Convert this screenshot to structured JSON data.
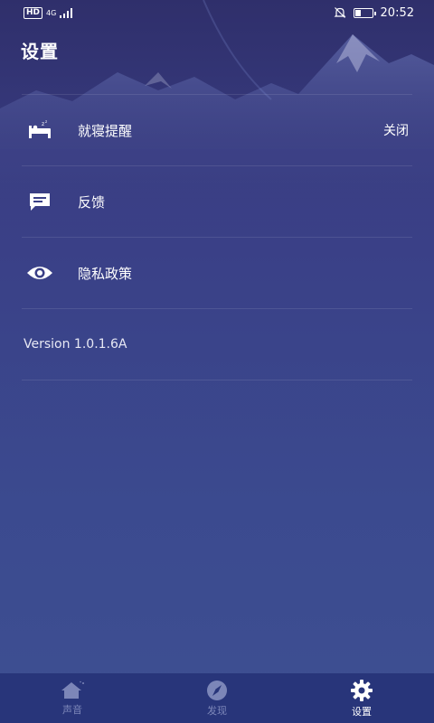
{
  "status_bar": {
    "badge": "HD",
    "network": "4G",
    "time": "20:52"
  },
  "page": {
    "title": "设置"
  },
  "settings": [
    {
      "label": "就寝提醒",
      "value": "关闭",
      "icon": "bed-icon"
    },
    {
      "label": "反馈",
      "value": "",
      "icon": "message-icon"
    },
    {
      "label": "隐私政策",
      "value": "",
      "icon": "eye-icon"
    }
  ],
  "version": "Version 1.0.1.6A",
  "tabs": [
    {
      "label": "声音",
      "icon": "home-icon",
      "active": false
    },
    {
      "label": "发现",
      "icon": "compass-icon",
      "active": false
    },
    {
      "label": "设置",
      "icon": "gear-icon",
      "active": true
    }
  ],
  "colors": {
    "tabbar": "#28357a",
    "active_tab": "#ffffff",
    "inactive_tab": "#7c86b8"
  }
}
